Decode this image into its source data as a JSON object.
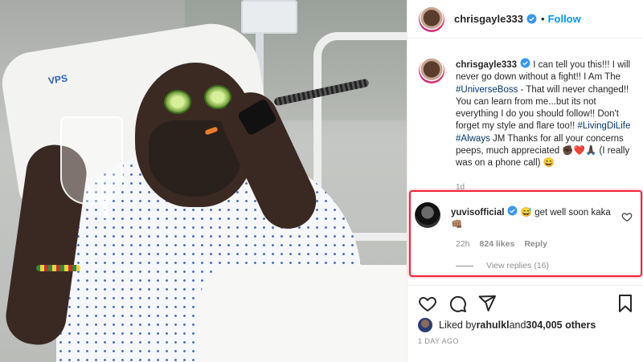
{
  "post": {
    "username": "chrisgayle333",
    "follow_label": "Follow",
    "separator": "•",
    "caption_user": "chrisgayle333",
    "caption_part1": " I can tell you this!!! I will never go down without a fight!! I Am The ",
    "caption_tag1": "#UniverseBoss",
    "caption_part2": " - That will never changed!! You can learn from me...but its not everything I do you should follow!! Don't forget my style and flare too!! ",
    "caption_tag2": "#LivingDiLife",
    "caption_tag3": "#Always",
    "caption_part3": " JM Thanks for all your concerns peeps, much appreciated ",
    "caption_emojis": "✊🏿❤️🙏🏿",
    "caption_part4": " (I really was on a phone call) ",
    "caption_emoji_end": "😄",
    "caption_time": "1d"
  },
  "comment": {
    "username": "yuvisofficial",
    "text": " get well soon kaka ",
    "emoji_a": "😅",
    "emoji_b": "👊🏽",
    "time": "22h",
    "likes": "824 likes",
    "reply": "Reply",
    "view_replies": "View replies (16)"
  },
  "likes": {
    "prefix": "Liked by ",
    "user": "rahulkl",
    "middle": " and ",
    "count": "304,005 others"
  },
  "date": "1 DAY AGO",
  "photo": {
    "brand_tag": "VPS"
  },
  "colors": {
    "accent": "#0095f6",
    "highlight": "#f2263a",
    "tag": "#00376b"
  }
}
